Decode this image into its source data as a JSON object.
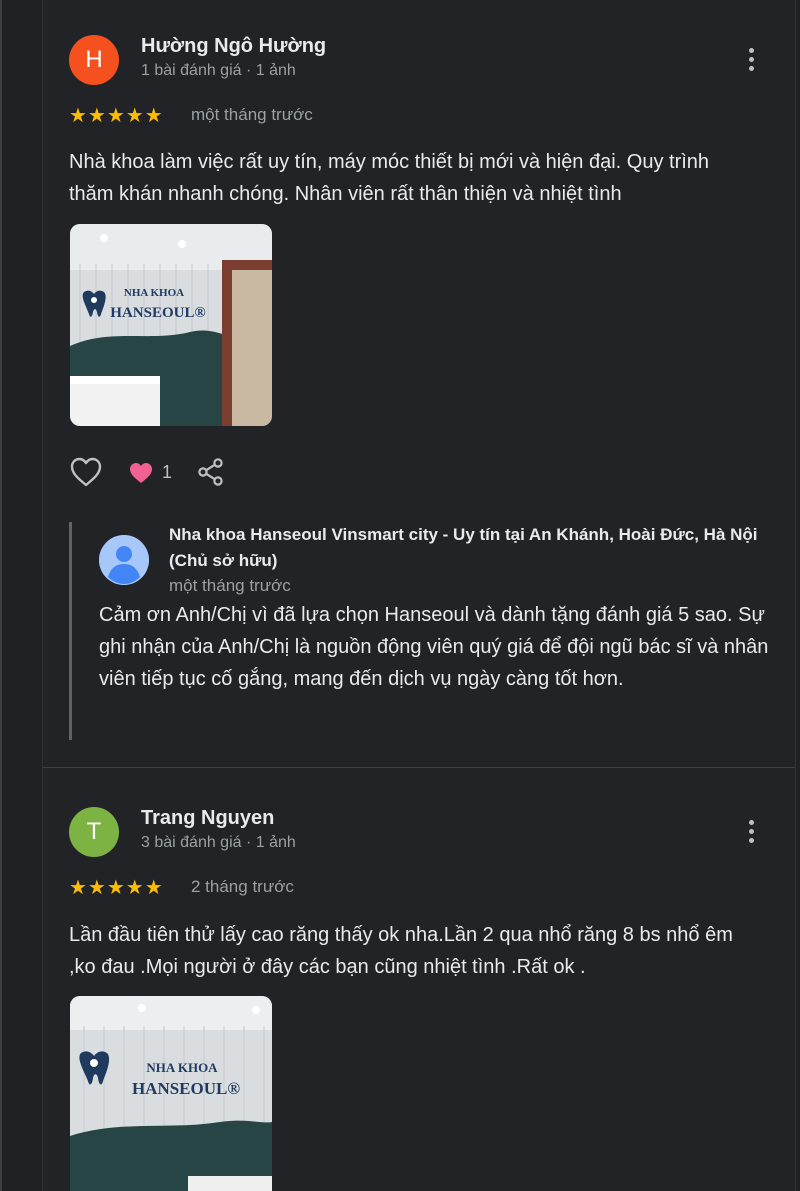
{
  "reviews": [
    {
      "avatar_letter": "H",
      "avatar_color": "#f4511e",
      "reviewer_name": "Hường Ngô Hường",
      "reviewer_meta": "1 bài đánh giá · 1 ảnh",
      "rating": 5,
      "stars": "★★★★★",
      "date": "một tháng trước",
      "text": "Nhà khoa làm việc rất uy tín, máy móc thiết bị mới và hiện đại. Quy trình thăm khán nhanh chóng. Nhân viên rất thân thiện và nhiệt tình",
      "photo": {
        "sign_line1": "NHA KHOA",
        "sign_line2": "HANSEOUL®"
      },
      "reaction_count": "1",
      "owner_reply": {
        "name": "Nha khoa Hanseoul Vinsmart city - Uy tín tại An Khánh, Hoài Đức, Hà Nội (Chủ sở hữu)",
        "date": "một tháng trước",
        "text": "Cảm ơn Anh/Chị vì đã lựa chọn Hanseoul và dành tặng đánh giá 5 sao. Sự ghi nhận của Anh/Chị là nguồn động viên quý giá để đội ngũ bác sĩ và nhân viên tiếp tục cố gắng, mang đến dịch vụ ngày càng tốt hơn."
      }
    },
    {
      "avatar_letter": "T",
      "avatar_color": "#7cb342",
      "reviewer_name": "Trang Nguyen",
      "reviewer_meta": "3 bài đánh giá · 1 ảnh",
      "rating": 5,
      "stars": "★★★★★",
      "date": "2 tháng trước",
      "text": "Lần đầu tiên thử lấy cao răng thấy ok nha.Lần 2 qua nhổ răng 8 bs nhổ êm ,ko đau .Mọi người ở đây các bạn cũng nhiệt tình .Rất ok .",
      "photo": {
        "sign_line1": "NHA KHOA",
        "sign_line2": "HANSEOUL®"
      }
    }
  ],
  "icons": {
    "menu": "kebab-menu-icon",
    "like": "thumbs-up-heart-outline-icon",
    "reaction": "heart-icon",
    "share": "share-icon"
  },
  "colors": {
    "star": "#fbbc04",
    "heart": "#f06292",
    "background": "#202124"
  }
}
